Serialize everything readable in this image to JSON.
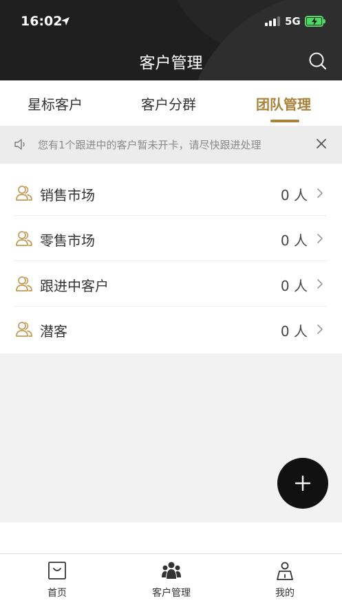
{
  "status_bar": {
    "time": "16:02",
    "network": "5G"
  },
  "header": {
    "title": "客户管理"
  },
  "tabs": [
    {
      "label": "星标客户",
      "active": false
    },
    {
      "label": "客户分群",
      "active": false
    },
    {
      "label": "团队管理",
      "active": true
    }
  ],
  "notice": {
    "text": "您有1个跟进中的客户暂未开卡，请尽快跟进处理"
  },
  "groups": [
    {
      "name": "销售市场",
      "count": "0 人"
    },
    {
      "name": "零售市场",
      "count": "0 人"
    },
    {
      "name": "跟进中客户",
      "count": "0 人"
    },
    {
      "name": "潜客",
      "count": "0 人"
    }
  ],
  "bottom_nav": [
    {
      "label": "首页",
      "icon": "shopping-bag-icon"
    },
    {
      "label": "客户管理",
      "icon": "group-icon"
    },
    {
      "label": "我的",
      "icon": "profile-badge-icon"
    }
  ],
  "colors": {
    "accent": "#a8823a",
    "header_bg": "#1f1f1f",
    "fab": "#111111"
  }
}
